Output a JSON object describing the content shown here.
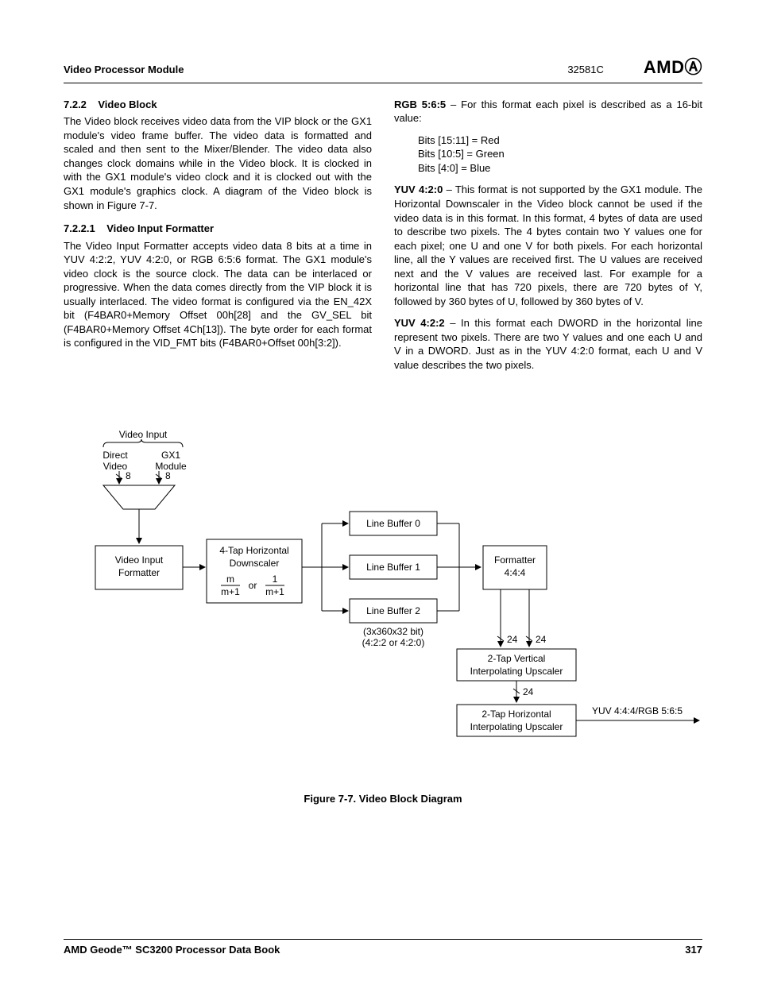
{
  "header": {
    "title": "Video Processor Module",
    "docnum": "32581C",
    "logo": "AMD"
  },
  "section": {
    "num": "7.2.2",
    "title": "Video Block",
    "para1": "The Video block receives video data from the VIP block or the GX1 module's video frame buffer. The video data is formatted and scaled and then sent to the Mixer/Blender. The video data also changes clock domains while in the Video block. It is clocked in with the GX1 module's video clock and it is clocked out with the GX1 module's graphics clock. A diagram of the Video block is shown in Figure 7-7."
  },
  "subsection": {
    "num": "7.2.2.1",
    "title": "Video Input Formatter",
    "para1": "The Video Input Formatter accepts video data 8 bits at a time in YUV 4:2:2, YUV 4:2:0, or RGB 6:5:6 format. The GX1 module's video clock is the source clock. The data can be interlaced or progressive. When the data comes directly from the VIP block it is usually interlaced. The video format is configured via the EN_42X bit (F4BAR0+Memory Offset 00h[28] and the GV_SEL bit (F4BAR0+Memory Offset 4Ch[13]). The byte order for each format is configured in the VID_FMT bits (F4BAR0+Offset 00h[3:2])."
  },
  "right_col": {
    "rgb_label": "RGB 5:6:5",
    "rgb_text": " – For this format each pixel is described as a 16-bit value:",
    "bits_red": "Bits [15:11] = Red",
    "bits_green": "Bits [10:5] = Green",
    "bits_blue": "Bits [4:0] = Blue",
    "yuv420_label": "YUV 4:2:0",
    "yuv420_text": " – This format is not supported by the GX1 module. The Horizontal Downscaler in the Video block cannot be used if the video data is in this format. In this format, 4 bytes of data are used to describe two pixels. The 4 bytes contain two Y values one for each pixel; one U and one V for both pixels. For each horizontal line, all the Y values are received first. The U values are received next and the V values are received last. For example for a horizontal line that has 720 pixels, there are 720 bytes of Y, followed by 360 bytes of U, followed by 360 bytes of V.",
    "yuv422_label": "YUV 4:2:2",
    "yuv422_text": " – In this format each DWORD in the horizontal line represent two pixels. There are two Y values and one each U and V in a DWORD. Just as in the YUV 4:2:0 format, each U and V value describes the two pixels."
  },
  "diagram": {
    "video_input": "Video Input",
    "direct_video": "Direct\nVideo",
    "gx1_module": "GX1\nModule",
    "eight1": "8",
    "eight2": "8",
    "vif": "Video Input\nFormatter",
    "downscaler": "4-Tap Horizontal\nDownscaler",
    "m_frac": "m",
    "mp1_1": "m+1",
    "or": "or",
    "one": "1",
    "mp1_2": "m+1",
    "lb0": "Line Buffer 0",
    "lb1": "Line Buffer 1",
    "lb2": "Line Buffer 2",
    "lb_note": "(3x360x32 bit)\n(4:2:2 or 4:2:0)",
    "formatter": "Formatter\n4:4:4",
    "twentyfour1": "24",
    "twentyfour2": "24",
    "twentyfour3": "24",
    "vscaler": "2-Tap Vertical\nInterpolating Upscaler",
    "hscaler": "2-Tap Horizontal\nInterpolating Upscaler",
    "output": "YUV 4:4:4/RGB 5:6:5",
    "caption": "Figure 7-7.  Video Block Diagram"
  },
  "footer": {
    "book": "AMD Geode™ SC3200 Processor Data Book",
    "page": "317"
  }
}
